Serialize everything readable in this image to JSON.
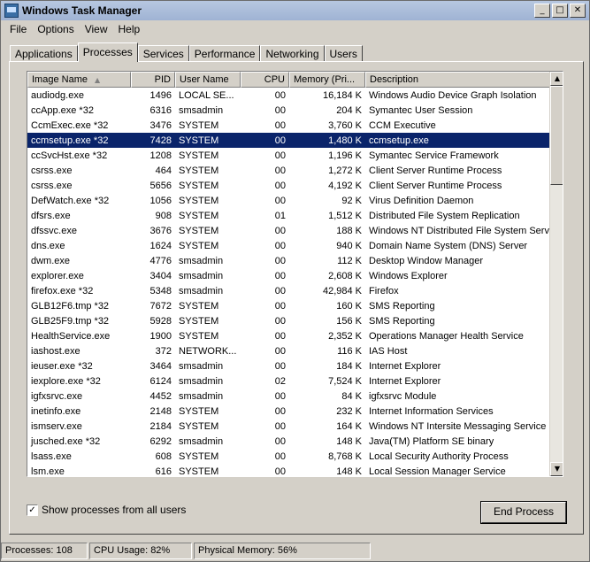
{
  "window": {
    "title": "Windows Task Manager"
  },
  "title_buttons": {
    "minimize": "_",
    "maximize": "□",
    "close": "✕"
  },
  "menu": [
    "File",
    "Options",
    "View",
    "Help"
  ],
  "tabs": [
    "Applications",
    "Processes",
    "Services",
    "Performance",
    "Networking",
    "Users"
  ],
  "active_tab": "Processes",
  "columns": {
    "image_name": "Image Name",
    "pid": "PID",
    "user_name": "User Name",
    "cpu": "CPU",
    "memory": "Memory (Pri...",
    "description": "Description"
  },
  "processes": [
    {
      "name": "audiodg.exe",
      "pid": "1496",
      "user": "LOCAL SE...",
      "cpu": "00",
      "mem": "16,184 K",
      "desc": "Windows Audio Device Graph Isolation"
    },
    {
      "name": "ccApp.exe *32",
      "pid": "6316",
      "user": "smsadmin",
      "cpu": "00",
      "mem": "204 K",
      "desc": "Symantec User Session"
    },
    {
      "name": "CcmExec.exe *32",
      "pid": "3476",
      "user": "SYSTEM",
      "cpu": "00",
      "mem": "3,760 K",
      "desc": "CCM Executive"
    },
    {
      "name": "ccmsetup.exe *32",
      "pid": "7428",
      "user": "SYSTEM",
      "cpu": "00",
      "mem": "1,480 K",
      "desc": "ccmsetup.exe",
      "selected": true
    },
    {
      "name": "ccSvcHst.exe *32",
      "pid": "1208",
      "user": "SYSTEM",
      "cpu": "00",
      "mem": "1,196 K",
      "desc": "Symantec Service Framework"
    },
    {
      "name": "csrss.exe",
      "pid": "464",
      "user": "SYSTEM",
      "cpu": "00",
      "mem": "1,272 K",
      "desc": "Client Server Runtime Process"
    },
    {
      "name": "csrss.exe",
      "pid": "5656",
      "user": "SYSTEM",
      "cpu": "00",
      "mem": "4,192 K",
      "desc": "Client Server Runtime Process"
    },
    {
      "name": "DefWatch.exe *32",
      "pid": "1056",
      "user": "SYSTEM",
      "cpu": "00",
      "mem": "92 K",
      "desc": "Virus Definition Daemon"
    },
    {
      "name": "dfsrs.exe",
      "pid": "908",
      "user": "SYSTEM",
      "cpu": "01",
      "mem": "1,512 K",
      "desc": "Distributed File System Replication"
    },
    {
      "name": "dfssvc.exe",
      "pid": "3676",
      "user": "SYSTEM",
      "cpu": "00",
      "mem": "188 K",
      "desc": "Windows NT Distributed File System Servic"
    },
    {
      "name": "dns.exe",
      "pid": "1624",
      "user": "SYSTEM",
      "cpu": "00",
      "mem": "940 K",
      "desc": "Domain Name System (DNS) Server"
    },
    {
      "name": "dwm.exe",
      "pid": "4776",
      "user": "smsadmin",
      "cpu": "00",
      "mem": "112 K",
      "desc": "Desktop Window Manager"
    },
    {
      "name": "explorer.exe",
      "pid": "3404",
      "user": "smsadmin",
      "cpu": "00",
      "mem": "2,608 K",
      "desc": "Windows Explorer"
    },
    {
      "name": "firefox.exe *32",
      "pid": "5348",
      "user": "smsadmin",
      "cpu": "00",
      "mem": "42,984 K",
      "desc": "Firefox"
    },
    {
      "name": "GLB12F6.tmp *32",
      "pid": "7672",
      "user": "SYSTEM",
      "cpu": "00",
      "mem": "160 K",
      "desc": "SMS Reporting"
    },
    {
      "name": "GLB25F9.tmp *32",
      "pid": "5928",
      "user": "SYSTEM",
      "cpu": "00",
      "mem": "156 K",
      "desc": "SMS Reporting"
    },
    {
      "name": "HealthService.exe",
      "pid": "1900",
      "user": "SYSTEM",
      "cpu": "00",
      "mem": "2,352 K",
      "desc": "Operations Manager Health Service"
    },
    {
      "name": "iashost.exe",
      "pid": "372",
      "user": "NETWORK...",
      "cpu": "00",
      "mem": "116 K",
      "desc": "IAS Host"
    },
    {
      "name": "ieuser.exe *32",
      "pid": "3464",
      "user": "smsadmin",
      "cpu": "00",
      "mem": "184 K",
      "desc": "Internet Explorer"
    },
    {
      "name": "iexplore.exe *32",
      "pid": "6124",
      "user": "smsadmin",
      "cpu": "02",
      "mem": "7,524 K",
      "desc": "Internet Explorer"
    },
    {
      "name": "igfxsrvc.exe",
      "pid": "4452",
      "user": "smsadmin",
      "cpu": "00",
      "mem": "84 K",
      "desc": "igfxsrvc Module"
    },
    {
      "name": "inetinfo.exe",
      "pid": "2148",
      "user": "SYSTEM",
      "cpu": "00",
      "mem": "232 K",
      "desc": "Internet Information Services"
    },
    {
      "name": "ismserv.exe",
      "pid": "2184",
      "user": "SYSTEM",
      "cpu": "00",
      "mem": "164 K",
      "desc": "Windows NT Intersite Messaging Service"
    },
    {
      "name": "jusched.exe *32",
      "pid": "6292",
      "user": "smsadmin",
      "cpu": "00",
      "mem": "148 K",
      "desc": "Java(TM) Platform SE binary"
    },
    {
      "name": "lsass.exe",
      "pid": "608",
      "user": "SYSTEM",
      "cpu": "00",
      "mem": "8,768 K",
      "desc": "Local Security Authority Process"
    },
    {
      "name": "lsm.exe",
      "pid": "616",
      "user": "SYSTEM",
      "cpu": "00",
      "mem": "148 K",
      "desc": "Local Session Manager Service"
    }
  ],
  "show_all": {
    "label": "Show processes from all users",
    "checked": "✓"
  },
  "end_process_label": "End Process",
  "status": {
    "processes": "Processes: 108",
    "cpu": "CPU Usage: 82%",
    "memory": "Physical Memory: 56%"
  }
}
